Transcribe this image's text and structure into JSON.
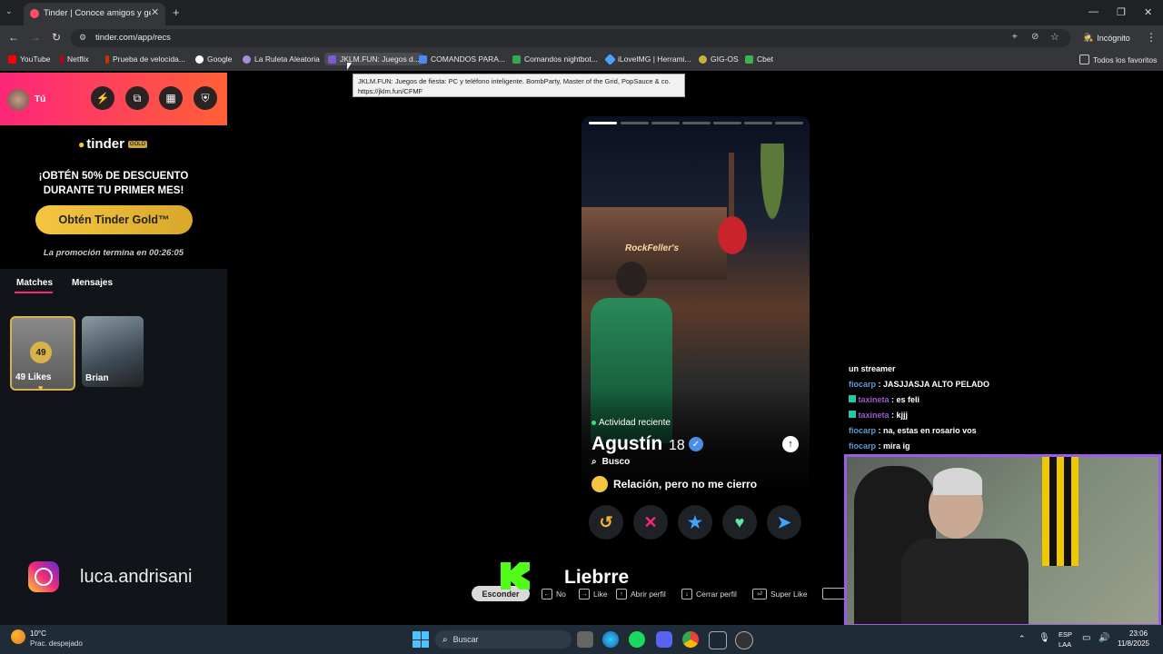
{
  "browser": {
    "tab_title": "Tinder | Conoce amigos y gente",
    "url": "tinder.com/app/recs",
    "incognito_label": "Incógnito",
    "bookmarks": [
      "YouTube",
      "Netflix",
      "Prueba de velocida...",
      "Google",
      "La Ruleta Aleatoria",
      "JKLM.FUN: Juegos d...",
      "COMANDOS PARA...",
      "Comandos nightbot...",
      "iLoveIMG | Herrami...",
      "GIG-OS",
      "Cbet"
    ],
    "all_bookmarks": "Todos los favoritos",
    "tooltip_line1": "JKLM.FUN: Juegos de fiesta: PC y teléfono inteligente. BombParty, Master of the Grid, PopSauce & co.",
    "tooltip_line2": "https://jklm.fun/CFMF"
  },
  "sidebar": {
    "user_label": "Tú",
    "brand": "tinder",
    "brand_badge": "GOLD",
    "promo_text": "¡OBTÉN 50% DE DESCUENTO DURANTE TU PRIMER MES!",
    "gold_button": "Obtén Tinder Gold™",
    "promo_timer": "La promoción termina en 00:26:05",
    "tabs": [
      "Matches",
      "Mensajes"
    ],
    "likes_count": "49",
    "likes_label": "49 Likes",
    "match_name": "Brian",
    "instagram": "luca.andrisani"
  },
  "profile": {
    "activity": "Actividad reciente",
    "name": "Agustín",
    "age": "18",
    "looking_label": "Busco",
    "looking_value": "Relación, pero no me cierro",
    "photo_count": 7,
    "current_photo": 1,
    "sign_text": "RockFeller's"
  },
  "shortcuts": {
    "hide": "Esconder",
    "no": "No",
    "like": "Like",
    "open": "Abrir perfil",
    "close": "Cerrar perfil",
    "super": "Super Like"
  },
  "stream": {
    "overlay_name": "Liebrre",
    "chat": [
      {
        "user": "",
        "text": "un streamer",
        "color": "#ffffff"
      },
      {
        "user": "fiocarp",
        "text": ": JASJJASJA ALTO PELADO",
        "color": "#5b9bd5"
      },
      {
        "user": "taxineta",
        "text": ": es feli",
        "color": "#9b59d0"
      },
      {
        "user": "taxineta",
        "text": ": kjjj",
        "color": "#9b59d0"
      },
      {
        "user": "fiocarp",
        "text": ": na, estas en rosario vos",
        "color": "#5b9bd5"
      },
      {
        "user": "fiocarp",
        "text": ": mira ig",
        "color": "#5b9bd5"
      }
    ]
  },
  "taskbar": {
    "weather_temp": "10°C",
    "weather_desc": "Prac. despejado",
    "search": "Buscar",
    "lang1": "ESP",
    "lang2": "LAA",
    "time": "23:06",
    "date": "11/8/2025"
  }
}
